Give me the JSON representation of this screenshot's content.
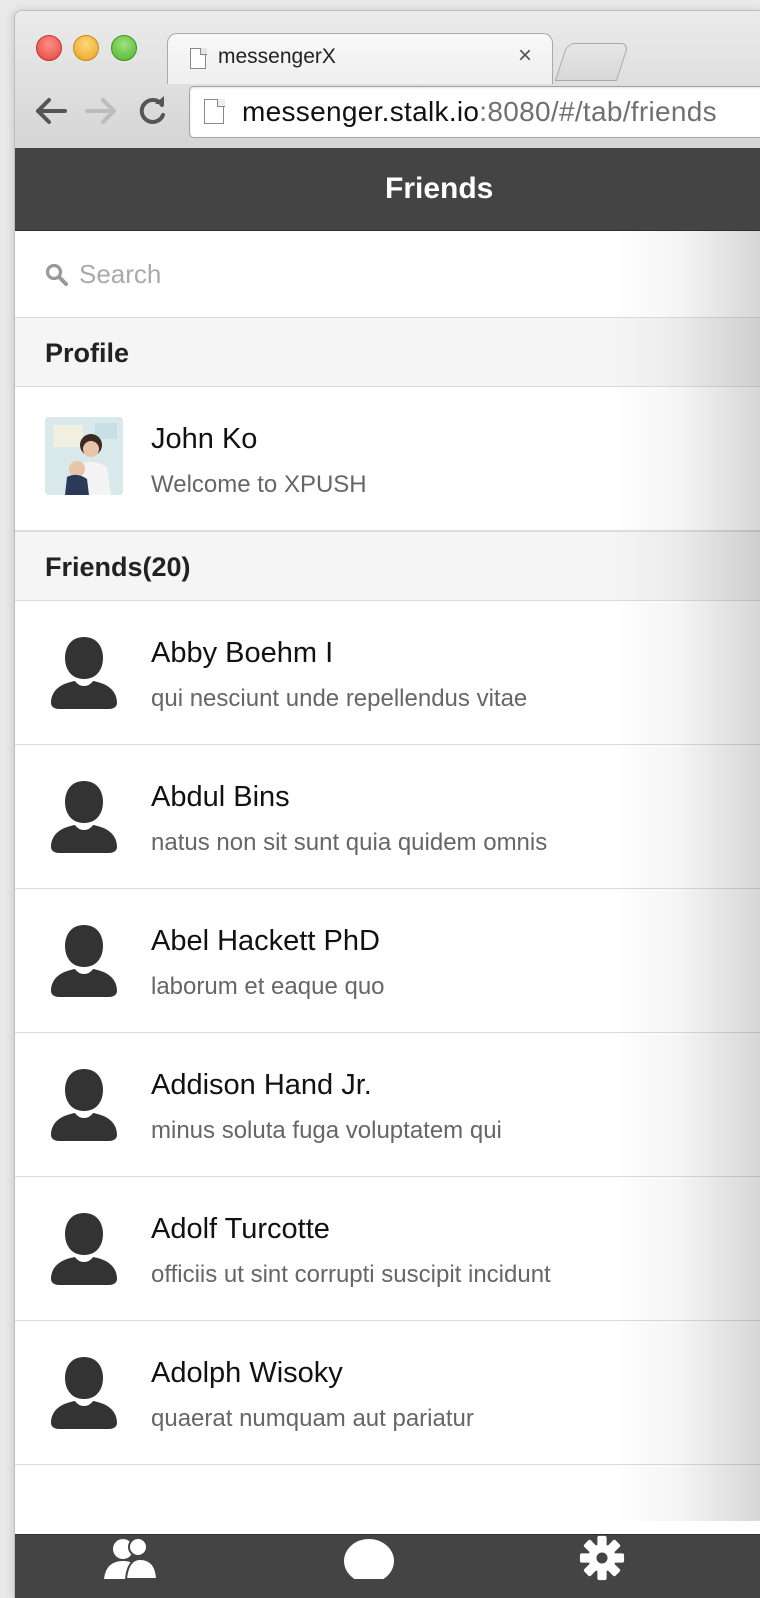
{
  "browser": {
    "tab_title": "messengerX",
    "tab_close": "×",
    "url_host": "messenger.stalk.io",
    "url_rest": ":8080/#/tab/friends"
  },
  "header": {
    "title": "Friends"
  },
  "search": {
    "placeholder": "Search",
    "value": ""
  },
  "sections": {
    "profile": "Profile",
    "friends": "Friends(20)"
  },
  "profile": {
    "name": "John Ko",
    "message": "Welcome to XPUSH"
  },
  "friends": [
    {
      "name": "Abby Boehm I",
      "message": "qui nesciunt unde repellendus vitae"
    },
    {
      "name": "Abdul Bins",
      "message": "natus non sit sunt quia quidem omnis"
    },
    {
      "name": "Abel Hackett PhD",
      "message": "laborum et eaque quo"
    },
    {
      "name": "Addison Hand Jr.",
      "message": "minus soluta fuga voluptatem qui"
    },
    {
      "name": "Adolf Turcotte",
      "message": "officiis ut sint corrupti suscipit incidunt"
    },
    {
      "name": "Adolph Wisoky",
      "message": "quaerat numquam aut pariatur"
    }
  ],
  "tabbar": {
    "items": [
      "friends-tab",
      "chats-tab",
      "settings-tab"
    ]
  },
  "colors": {
    "header_bg": "#444444",
    "section_bg": "#f5f5f5",
    "avatar_silhouette": "#333333"
  }
}
